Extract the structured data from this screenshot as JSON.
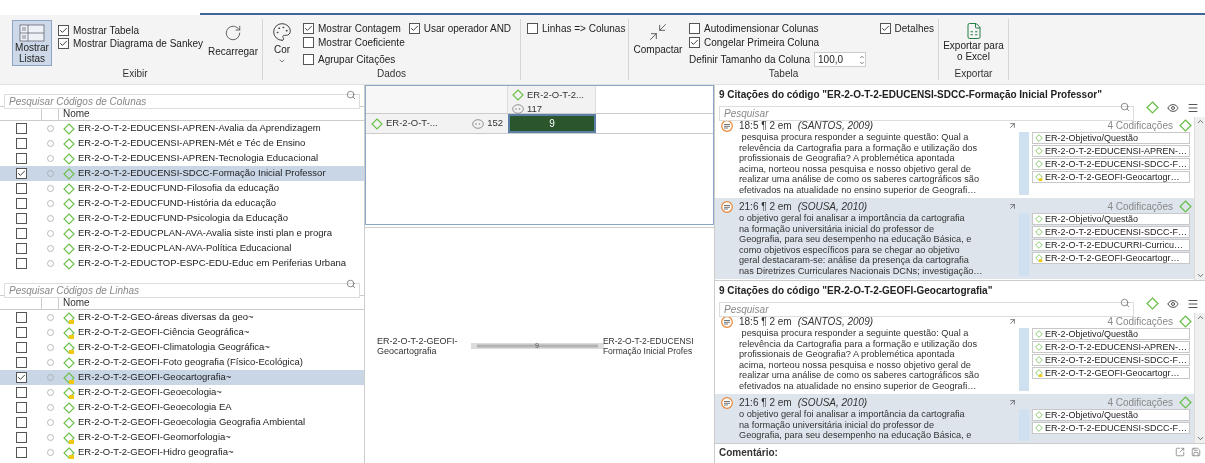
{
  "ribbon": {
    "show_lists": {
      "label": "Mostrar Listas",
      "selected": true
    },
    "display_checks": [
      {
        "label": "Mostrar Tabela",
        "checked": true
      },
      {
        "label": "Mostrar Diagrama de Sankey",
        "checked": true
      }
    ],
    "reload": "Recarregar",
    "group_display": "Exibir",
    "color_button": "Cor",
    "data_checks": [
      {
        "label": "Mostrar Contagem",
        "checked": true
      },
      {
        "label": "Usar operador AND",
        "checked": true
      },
      {
        "label": "Mostrar Coeficiente",
        "checked": false
      },
      {
        "label": "Agrupar Citações",
        "checked": false
      }
    ],
    "group_data": "Dados",
    "swap": {
      "label": "Linhas => Colunas",
      "checked": false
    },
    "compact": "Compactar",
    "table_checks": [
      {
        "label": "Autodimensionar Colunas",
        "checked": false
      },
      {
        "label": "Congelar Primeira Coluna",
        "checked": true
      },
      {
        "label": "Detalhes",
        "checked": true
      }
    ],
    "column_size": {
      "label": "Definir Tamanho da Coluna",
      "value": "100,0"
    },
    "group_table": "Tabela",
    "export": "Exportar para o Excel",
    "group_export": "Exportar"
  },
  "column_codes": {
    "placeholder": "Pesquisar Códigos de Colunas",
    "header": "Nome",
    "rows": [
      {
        "name": "ER-2-O-T-2-EDUCENSI-APREN-Avalia da Aprendizagem",
        "checked": false,
        "selected": false,
        "kind": "code"
      },
      {
        "name": "ER-2-O-T-2-EDUCENSI-APREN-Mét e Téc de Ensino",
        "checked": false,
        "selected": false,
        "kind": "code"
      },
      {
        "name": "ER-2-O-T-2-EDUCENSI-APREN-Tecnologia Educacional",
        "checked": false,
        "selected": false,
        "kind": "code"
      },
      {
        "name": "ER-2-O-T-2-EDUCENSI-SDCC-Formação Inicial Professor",
        "checked": true,
        "selected": true,
        "kind": "code"
      },
      {
        "name": "ER-2-O-T-2-EDUCFUND-Filosofia da educação",
        "checked": false,
        "selected": false,
        "kind": "code"
      },
      {
        "name": "ER-2-O-T-2-EDUCFUND-História da educação",
        "checked": false,
        "selected": false,
        "kind": "code"
      },
      {
        "name": "ER-2-O-T-2-EDUCFUND-Psicologia da Educação",
        "checked": false,
        "selected": false,
        "kind": "code"
      },
      {
        "name": "ER-2-O-T-2-EDUCPLAN-AVA-Avalia siste insti plan e progra",
        "checked": false,
        "selected": false,
        "kind": "code"
      },
      {
        "name": "ER-2-O-T-2-EDUCPLAN-AVA-Política Educacional",
        "checked": false,
        "selected": false,
        "kind": "code"
      },
      {
        "name": "ER-2-O-T-2-EDUCTOP-ESPC-EDU-Educ em Periferias Urbana",
        "checked": false,
        "selected": false,
        "kind": "code"
      }
    ]
  },
  "row_codes": {
    "placeholder": "Pesquisar Códigos de Linhas",
    "header": "Nome",
    "rows": [
      {
        "name": "ER-2-O-T-2-GEO-áreas diversas da geo~",
        "checked": false,
        "selected": false,
        "kind": "memo_code"
      },
      {
        "name": "ER-2-O-T-2-GEOFI-Ciência Geográfica~",
        "checked": false,
        "selected": false,
        "kind": "memo_code"
      },
      {
        "name": "ER-2-O-T-2-GEOFI-Climatologia Geográfica~",
        "checked": false,
        "selected": false,
        "kind": "memo_code"
      },
      {
        "name": "ER-2-O-T-2-GEOFI-Foto geografia (Físico-Ecológica)",
        "checked": false,
        "selected": false,
        "kind": "code"
      },
      {
        "name": "ER-2-O-T-2-GEOFI-Geocartografia~",
        "checked": true,
        "selected": true,
        "kind": "memo_code"
      },
      {
        "name": "ER-2-O-T-2-GEOFI-Geoecologia~",
        "checked": false,
        "selected": false,
        "kind": "memo_code"
      },
      {
        "name": "ER-2-O-T-2-GEOFI-Geoecologia EA",
        "checked": false,
        "selected": false,
        "kind": "code"
      },
      {
        "name": "ER-2-O-T-2-GEOFI-Geoecologia Geografia Ambiental",
        "checked": false,
        "selected": false,
        "kind": "code"
      },
      {
        "name": "ER-2-O-T-2-GEOFI-Geomorfologia~",
        "checked": false,
        "selected": false,
        "kind": "memo_code"
      },
      {
        "name": "ER-2-O-T-2-GEOFI-Hidro geografia~",
        "checked": false,
        "selected": false,
        "kind": "memo_code"
      }
    ]
  },
  "table": {
    "columns": [
      {
        "name": "ER-2-O-T-2...",
        "count": "117"
      }
    ],
    "rows": [
      {
        "name": "ER-2-O-T-...",
        "count": "152",
        "cells": [
          {
            "value": "9",
            "selected": true
          }
        ]
      }
    ]
  },
  "sankey": {
    "source": [
      "ER-2-O-T-2-GEOFI-",
      "Geocartografia"
    ],
    "flow": "9",
    "target": [
      "ER-2-O-T-2-EDUCENSI",
      "Formação Inicial Profes"
    ]
  },
  "quotation_panels": [
    {
      "title": "9 Citações do código \"ER-2-O-T-2-EDUCENSI-SDCC-Formação Inicial Professor\"",
      "placeholder": "Pesquisar",
      "quotations": [
        {
          "ref": "18:5 ¶ 2 em",
          "source": "(SANTOS, 2009)",
          "selected": false,
          "codings": "4 Codificações",
          "lines": [
            " pesquisa procura responder a seguinte questão: Qual a",
            "relevência da Cartografia para a formação e utilização dos",
            "profissionais de Geografia? A problemética apontada",
            "acima, norteou nossa pesquisa e nosso objetivo geral de",
            "realizar uma análise de como os saberes cartográficos são",
            "efetivados na atualidade no ensino superior de Geografi…"
          ],
          "codes": [
            {
              "name": "ER-2-Objetivo/Questão",
              "kind": "code"
            },
            {
              "name": "ER-2-O-T-2-EDUCENSI-APREN-…",
              "kind": "code"
            },
            {
              "name": "ER-2-O-T-2-EDUCENSI-SDCC-F…",
              "kind": "code"
            },
            {
              "name": "ER-2-O-T-2-GEOFI-Geocartogr…",
              "kind": "memo_code"
            }
          ]
        },
        {
          "ref": "21:6 ¶ 2 em",
          "source": "(SOUSA, 2010)",
          "selected": true,
          "codings": "4 Codificações",
          "lines": [
            "o objetivo geral foi analisar a importância da cartografia",
            "na formação universitária inicial do professor de",
            "Geografia, para seu desempenho na educação Básica, e",
            "como objetivos específicos para se chegar ao objetivo",
            "geral destacaram-se: análise da presença da cartografia",
            "nas Diretrizes Curriculares Nacionais DCNs; investigação…"
          ],
          "codes": [
            {
              "name": "ER-2-Objetivo/Questão",
              "kind": "code"
            },
            {
              "name": "ER-2-O-T-2-EDUCENSI-SDCC-F…",
              "kind": "code"
            },
            {
              "name": "ER-2-O-T-2-EDUCURRI-Curricu…",
              "kind": "code"
            },
            {
              "name": "ER-2-O-T-2-GEOFI-Geocartogr…",
              "kind": "memo_code"
            }
          ]
        }
      ]
    },
    {
      "title": "9 Citações do código \"ER-2-O-T-2-GEOFI-Geocartografia\"",
      "placeholder": "Pesquisar",
      "quotations": [
        {
          "ref": "18:5 ¶ 2 em",
          "source": "(SANTOS, 2009)",
          "selected": false,
          "codings": "4 Codificações",
          "lines": [
            " pesquisa procura responder a seguinte questão: Qual a",
            "relevência da Cartografia para a formação e utilização dos",
            "profissionais de Geografia? A problemética apontada",
            "acima, norteou nossa pesquisa e nosso objetivo geral de",
            "realizar uma análise de como os saberes cartográficos são",
            "efetivados na atualidade no ensino superior de Geografi…"
          ],
          "codes": [
            {
              "name": "ER-2-Objetivo/Questão",
              "kind": "code"
            },
            {
              "name": "ER-2-O-T-2-EDUCENSI-APREN-…",
              "kind": "code"
            },
            {
              "name": "ER-2-O-T-2-EDUCENSI-SDCC-F…",
              "kind": "code"
            },
            {
              "name": "ER-2-O-T-2-GEOFI-Geocartogr…",
              "kind": "memo_code"
            }
          ]
        },
        {
          "ref": "21:6 ¶ 2 em",
          "source": "(SOUSA, 2010)",
          "selected": true,
          "codings": "4 Codificações",
          "lines": [
            "o objetivo geral foi analisar a importância da cartografia",
            "na formação universitária inicial do professor de",
            "Geografia, para seu desempenho na educação Básica, e"
          ],
          "codes": [
            {
              "name": "ER-2-Objetivo/Questão",
              "kind": "code"
            },
            {
              "name": "ER-2-O-T-2-EDUCENSI-SDCC-F…",
              "kind": "code"
            }
          ]
        }
      ]
    }
  ],
  "comment": {
    "label": "Comentário:"
  }
}
